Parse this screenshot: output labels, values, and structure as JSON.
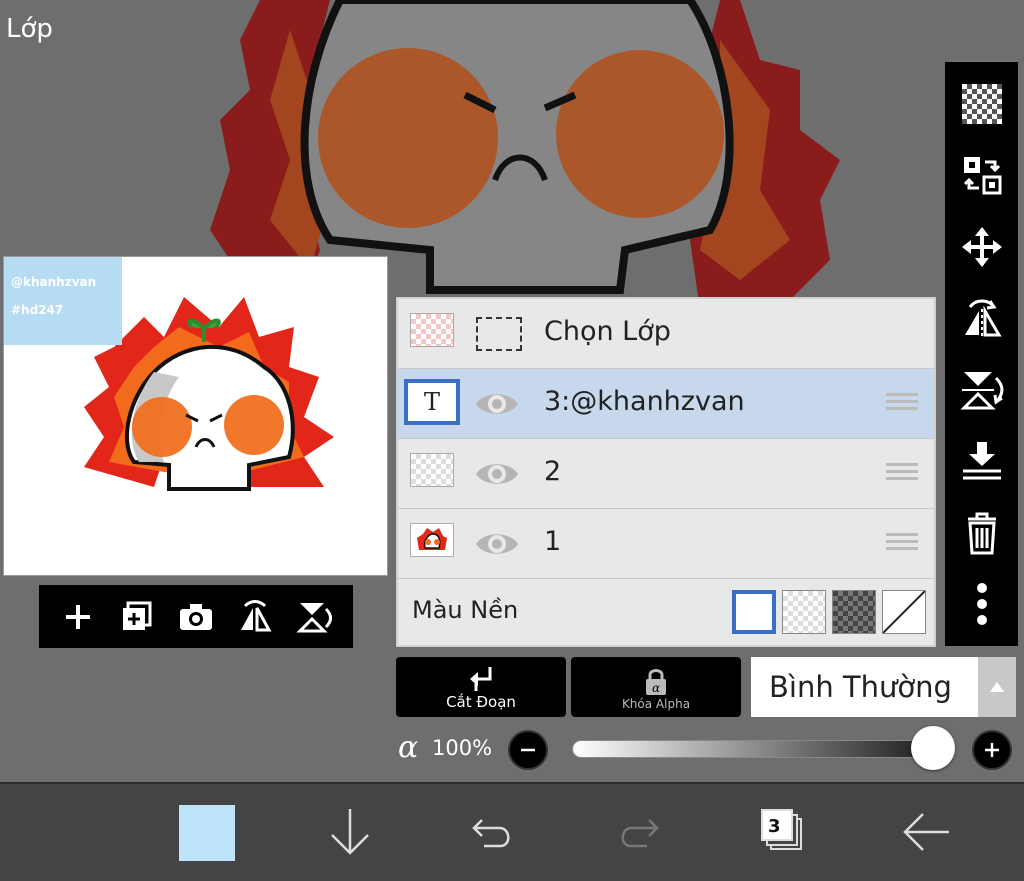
{
  "panel": {
    "title": "Lớp"
  },
  "preview": {
    "watermark_line1": "@khanhzvan",
    "watermark_line2": "#hd247"
  },
  "preview_toolbar": [
    "add-layer",
    "add-copy",
    "camera",
    "flip-horizontal",
    "flip-vertical"
  ],
  "right_toolbar": [
    "transparent-checker-icon",
    "swap-layer-icon",
    "move-icon",
    "flip-horizontal-icon",
    "flip-vertical-icon",
    "merge-down-icon",
    "trash-icon",
    "more-vertical-icon"
  ],
  "layers": {
    "select_label": "Chọn Lớp",
    "items": [
      {
        "name": "3:@khanhzvan",
        "type": "text",
        "selected": true,
        "visible": true
      },
      {
        "name": "2",
        "type": "raster",
        "selected": false,
        "visible": true
      },
      {
        "name": "1",
        "type": "raster",
        "selected": false,
        "visible": true
      }
    ],
    "background_label": "Màu Nền",
    "background_selected": "white"
  },
  "actions": {
    "clip_label": "Cắt Đoạn",
    "alpha_lock_label": "Khóa Alpha",
    "blend_mode": "Bình Thường"
  },
  "opacity": {
    "symbol": "α",
    "value_text": "100%",
    "value": 1.0
  },
  "bottom_bar": {
    "color": "#bfe3fb",
    "layer_count": "3"
  },
  "colors": {
    "accent": "#3a6fc4",
    "selected_row": "#c7d7ec",
    "flame_red": "#d9231a",
    "flame_orange": "#f4701e"
  }
}
